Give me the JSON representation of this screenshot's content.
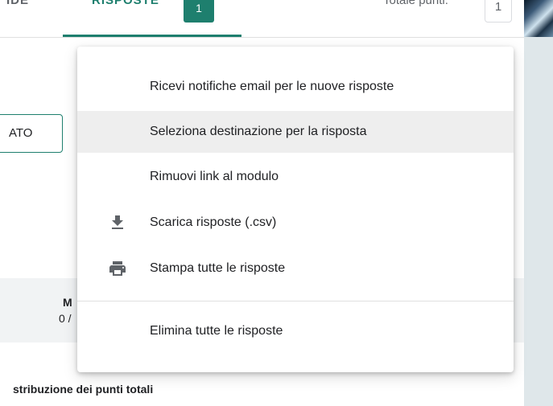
{
  "tabs": {
    "left_label": "IDE",
    "active_label": "RISPOSTE",
    "active_count": "1"
  },
  "points": {
    "label": "Totale punti:",
    "value": "1"
  },
  "background": {
    "button_label": "ATO",
    "stat_label": "M",
    "stat_value": "0 /",
    "section_title": "stribuzione dei punti totali"
  },
  "menu": {
    "items": [
      {
        "label": "Ricevi notifiche email per le nuove risposte",
        "icon": null
      },
      {
        "label": "Seleziona destinazione per la risposta",
        "icon": null,
        "highlighted": true
      },
      {
        "label": "Rimuovi link al modulo",
        "icon": null
      },
      {
        "label": "Scarica risposte (.csv)",
        "icon": "download-icon"
      },
      {
        "label": "Stampa tutte le risposte",
        "icon": "print-icon"
      },
      {
        "label": "Elimina tutte le risposte",
        "icon": null
      }
    ]
  },
  "colors": {
    "accent": "#1e7f6e",
    "menu_highlight": "#eeeeee",
    "icon_gray": "#5f6368"
  }
}
